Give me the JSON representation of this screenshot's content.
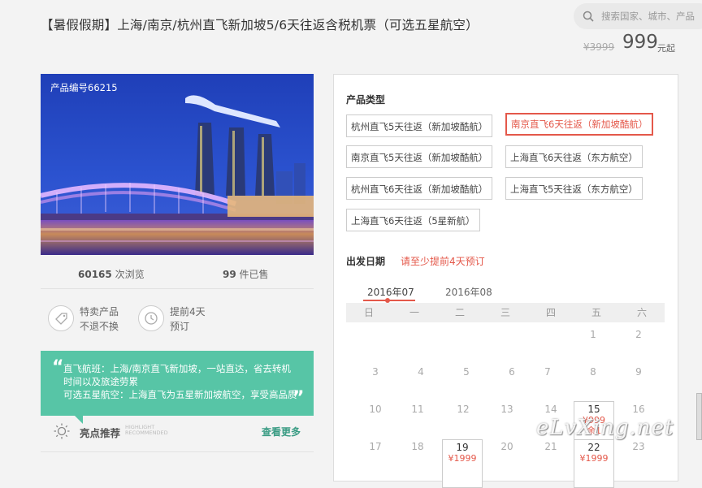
{
  "header": {
    "title": "【暑假假期】上海/南京/杭州直飞新加坡5/6天往返含税机票（可选五星航空）",
    "search_placeholder": "搜索国家、城市、产品",
    "price_old": "¥3999",
    "price_new": "999",
    "price_unit": "元起"
  },
  "product": {
    "number": "产品编号66215",
    "views_count": "60165",
    "views_label": "次浏览",
    "sold_count": "99",
    "sold_label": "件已售"
  },
  "features": [
    {
      "icon": "tag-icon",
      "line1": "特卖产品",
      "line2": "不退不换"
    },
    {
      "icon": "clock-icon",
      "line1": "提前4天",
      "line2": "预订"
    }
  ],
  "quote": {
    "open": "“",
    "close": "”",
    "text": "直飞航班：上海/南京直飞新加坡，一站直达，省去转机时间以及旅途劳累\n可选五星航空：上海直飞为五星新加坡航空，享受高品质服务"
  },
  "highlights": {
    "title": "亮点推荐",
    "en_line1": "HIGHLIGHT",
    "en_line2": "RECOMMENDED",
    "more": "查看更多"
  },
  "options": {
    "section_label": "产品类型",
    "items": [
      {
        "label": "杭州直飞5天往返（新加坡酷航）",
        "selected": false
      },
      {
        "label": "南京直飞6天往返（新加坡酷航）",
        "selected": true
      },
      {
        "label": "南京直飞5天往返（新加坡酷航）",
        "selected": false
      },
      {
        "label": "上海直飞6天往返（东方航空）",
        "selected": false
      },
      {
        "label": "杭州直飞6天往返（新加坡酷航）",
        "selected": false
      },
      {
        "label": "上海直飞5天往返（东方航空）",
        "selected": false
      },
      {
        "label": "上海直飞6天往返（5星新航）",
        "selected": false
      }
    ]
  },
  "calendar": {
    "section_label": "出发日期",
    "note": "请至少提前4天预订",
    "months": [
      "2016年07",
      "2016年08"
    ],
    "weekdays": [
      "日",
      "一",
      "二",
      "三",
      "四",
      "五",
      "六"
    ],
    "row1": [
      "1",
      "2"
    ],
    "row2": [
      "3",
      "4",
      "5",
      "6",
      "7",
      "8",
      "9"
    ],
    "row3": [
      "10",
      "11",
      "12",
      "13",
      "14",
      "15",
      "16"
    ],
    "row4": [
      "17",
      "18",
      "19",
      "20",
      "21",
      "22",
      "23"
    ],
    "price_15": "¥999",
    "price_15_extra": "余1",
    "price_19": "¥1999",
    "price_22": "¥1999"
  },
  "watermark": "eLvXing.net",
  "colors": {
    "accent_red": "#e4584a",
    "teal": "#57c5a6"
  }
}
